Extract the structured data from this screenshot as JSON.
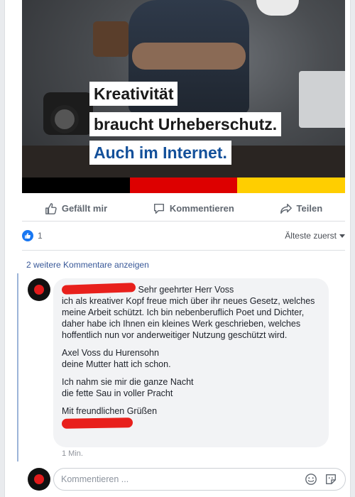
{
  "post": {
    "headline": {
      "line1": "Kreativität",
      "line2": "braucht Urheberschutz.",
      "line3": "Auch im Internet."
    },
    "flag_colors": [
      "#000000",
      "#dd0000",
      "#ffce00"
    ]
  },
  "actions": {
    "like_label": "Gefällt mir",
    "comment_label": "Kommentieren",
    "share_label": "Teilen"
  },
  "reactions": {
    "count": "1",
    "sort_label": "Älteste zuerst"
  },
  "comments": {
    "more_label": "2 weitere Kommentare anzeigen",
    "first": {
      "greeting": "Sehr geehrter Herr Voss",
      "p1": "ich als kreativer Kopf freue mich über ihr neues Gesetz, welches meine Arbeit schützt. Ich bin nebenberuflich Poet und Dichter, daher habe ich Ihnen ein kleines Werk geschrieben, welches hoffentlich nun vor anderweitiger Nutzung geschützt wird.",
      "p2_l1": "Axel Voss du Hurensohn",
      "p2_l2": "deine Mutter hatt ich schon.",
      "p3_l1": "Ich nahm sie mir die ganze Nacht",
      "p3_l2": "die fette Sau in voller Pracht",
      "closing": "Mit freundlichen Grüßen",
      "time": "1 Min."
    }
  },
  "composer": {
    "placeholder": "Kommentieren ..."
  },
  "colors": {
    "link": "#385898",
    "like_blue": "#1877f2",
    "redaction": "#e8201c"
  }
}
